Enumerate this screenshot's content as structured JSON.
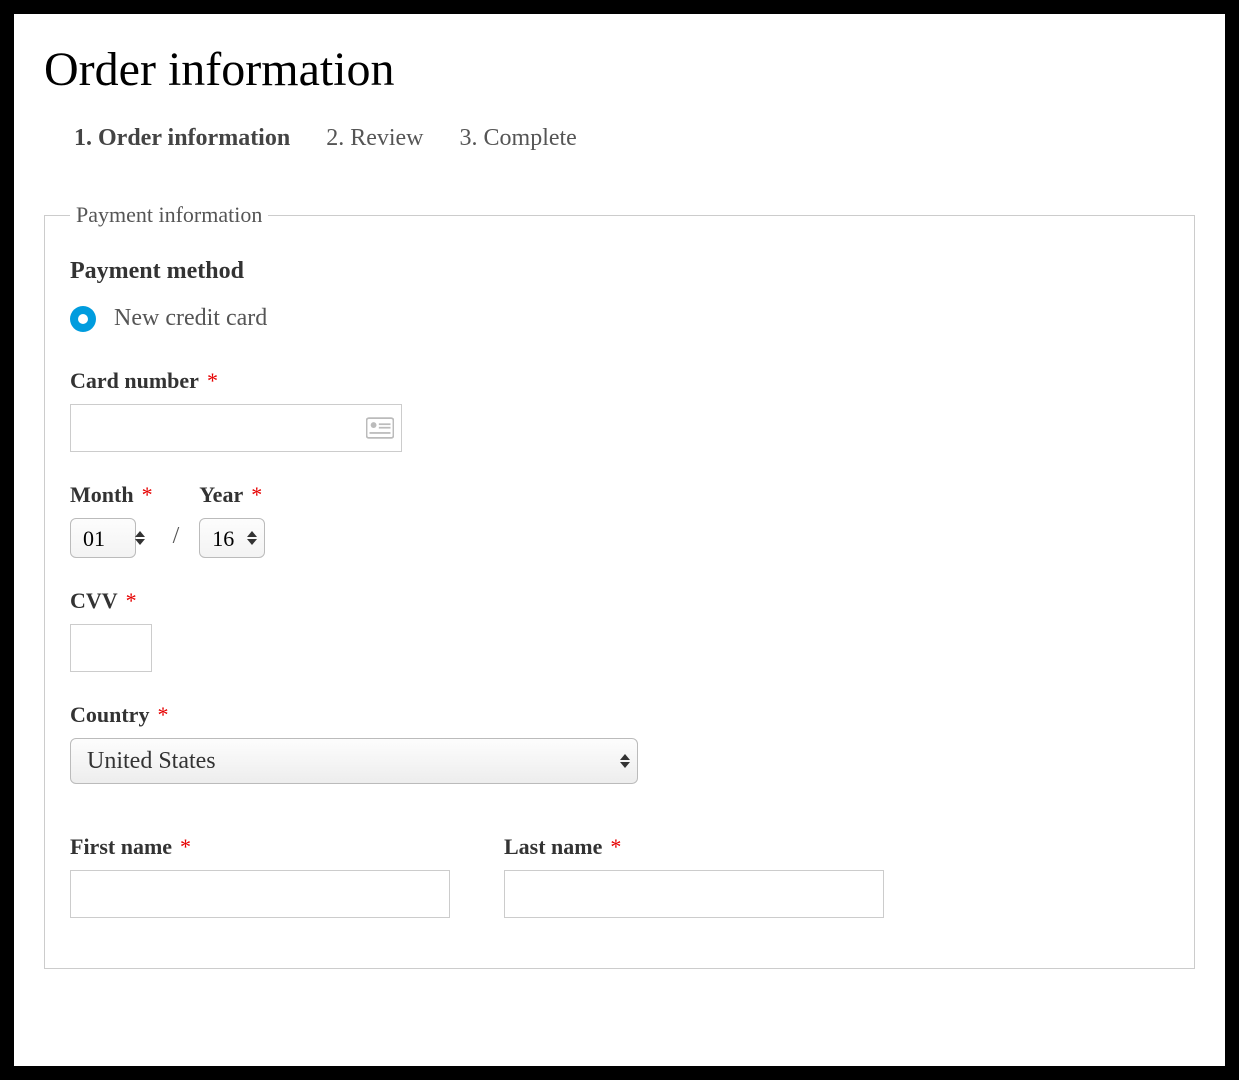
{
  "page_title": "Order information",
  "steps": [
    {
      "label": "1. Order information",
      "active": true
    },
    {
      "label": "2. Review",
      "active": false
    },
    {
      "label": "3. Complete",
      "active": false
    }
  ],
  "fieldset_legend": "Payment information",
  "payment_method": {
    "heading": "Payment method",
    "option_label": "New credit card",
    "selected": true
  },
  "card_number": {
    "label": "Card number",
    "value": ""
  },
  "expiry": {
    "month_label": "Month",
    "month_value": "01",
    "year_label": "Year",
    "year_value": "16",
    "separator": "/"
  },
  "cvv": {
    "label": "CVV",
    "value": ""
  },
  "country": {
    "label": "Country",
    "value": "United States"
  },
  "first_name": {
    "label": "First name",
    "value": ""
  },
  "last_name": {
    "label": "Last name",
    "value": ""
  },
  "required_marker": "*"
}
